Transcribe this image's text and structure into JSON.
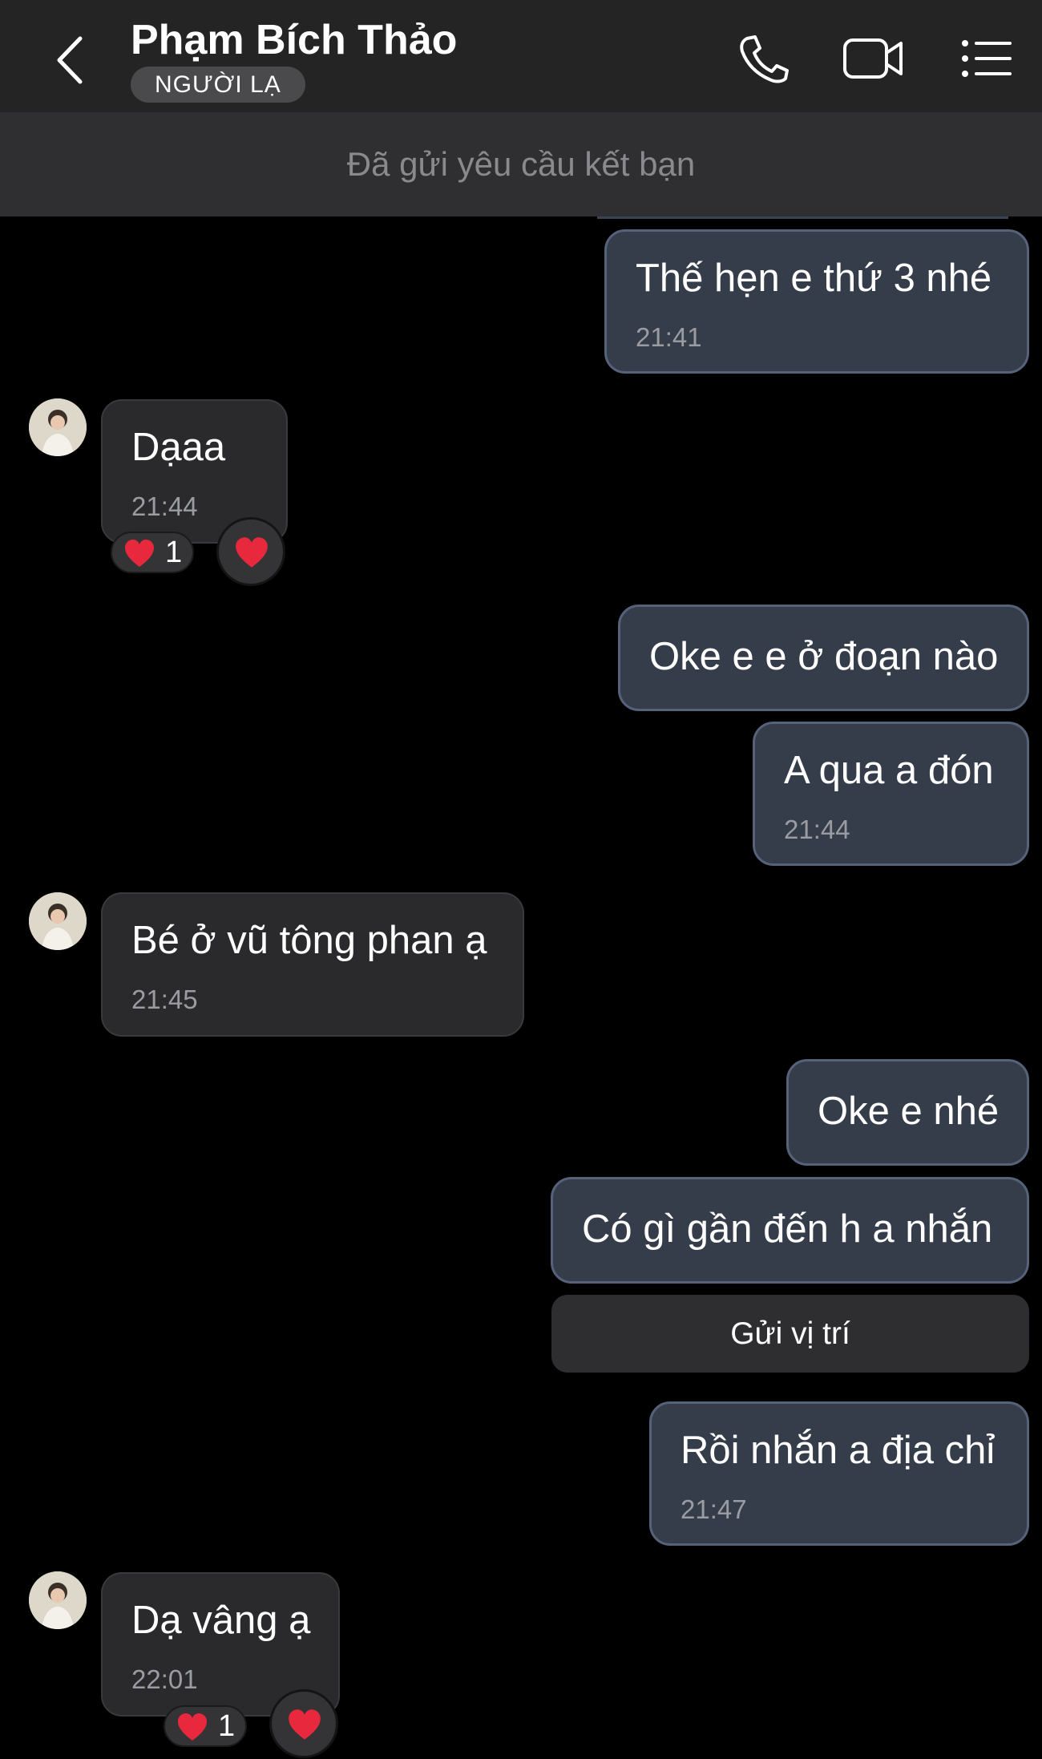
{
  "header": {
    "contact_name": "Phạm Bích Thảo",
    "badge": "NGƯỜI LẠ",
    "icons": [
      "back-chevron-icon",
      "phone-icon",
      "video-camera-icon",
      "list-menu-icon"
    ]
  },
  "banner": {
    "text": "Đã gửi yêu cầu kết bạn"
  },
  "messages": [
    {
      "direction": "outgoing",
      "text": "Thế hẹn e thứ 3 nhé",
      "time": "21:41"
    },
    {
      "direction": "incoming",
      "text": "Dạaa",
      "time": "21:44",
      "reaction_count": "1"
    },
    {
      "direction": "outgoing",
      "text": "Oke e e ở đoạn nào"
    },
    {
      "direction": "outgoing",
      "text": "A qua a đón",
      "time": "21:44"
    },
    {
      "direction": "incoming",
      "text": "Bé ở vũ tông phan ạ",
      "time": "21:45"
    },
    {
      "direction": "outgoing",
      "text": "Oke e nhé"
    },
    {
      "direction": "outgoing",
      "text": "Có gì gần đến h a nhắn"
    },
    {
      "direction": "outgoing",
      "text": "Rồi nhắn a địa chỉ",
      "time": "21:47"
    },
    {
      "direction": "incoming",
      "text": "Dạ vâng ạ",
      "time": "22:01",
      "reaction_count": "1"
    }
  ],
  "action_button": {
    "label": "Gửi vị trí"
  },
  "colors": {
    "background": "#000000",
    "header": "#242424",
    "outgoing_bubble": "#363d4a",
    "outgoing_border": "#55627a",
    "incoming_bubble": "#2a2a2c",
    "reaction_heart": "#e8283c"
  }
}
